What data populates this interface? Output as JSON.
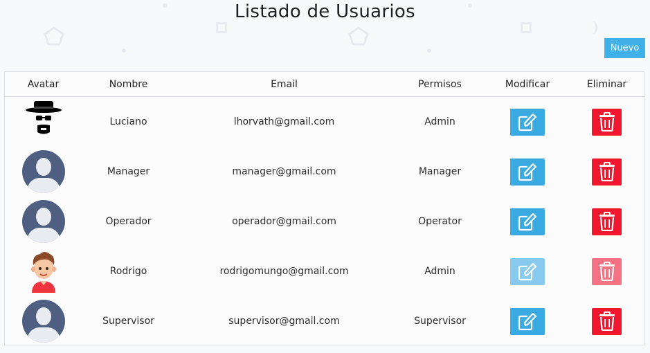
{
  "page": {
    "title": "Listado de Usuarios",
    "new_button_label": "Nuevo"
  },
  "table": {
    "headers": {
      "avatar": "Avatar",
      "nombre": "Nombre",
      "email": "Email",
      "permisos": "Permisos",
      "modificar": "Modificar",
      "eliminar": "Eliminar"
    },
    "rows": [
      {
        "avatar": "heisenberg-avatar",
        "nombre": "Luciano",
        "email": "lhorvath@gmail.com",
        "permisos": "Admin"
      },
      {
        "avatar": "default-user-avatar",
        "nombre": "Manager",
        "email": "manager@gmail.com",
        "permisos": "Manager"
      },
      {
        "avatar": "default-user-avatar",
        "nombre": "Operador",
        "email": "operador@gmail.com",
        "permisos": "Operator"
      },
      {
        "avatar": "cartoon-boy-avatar",
        "nombre": "Rodrigo",
        "email": "rodrigomungo@gmail.com",
        "permisos": "Admin"
      },
      {
        "avatar": "default-user-avatar",
        "nombre": "Supervisor",
        "email": "supervisor@gmail.com",
        "permisos": "Supervisor"
      }
    ]
  },
  "icons": {
    "edit": "edit-icon",
    "delete": "trash-icon"
  },
  "colors": {
    "edit_button": "#3aaae3",
    "delete_button": "#f0182f",
    "new_button": "#41b0e6"
  }
}
